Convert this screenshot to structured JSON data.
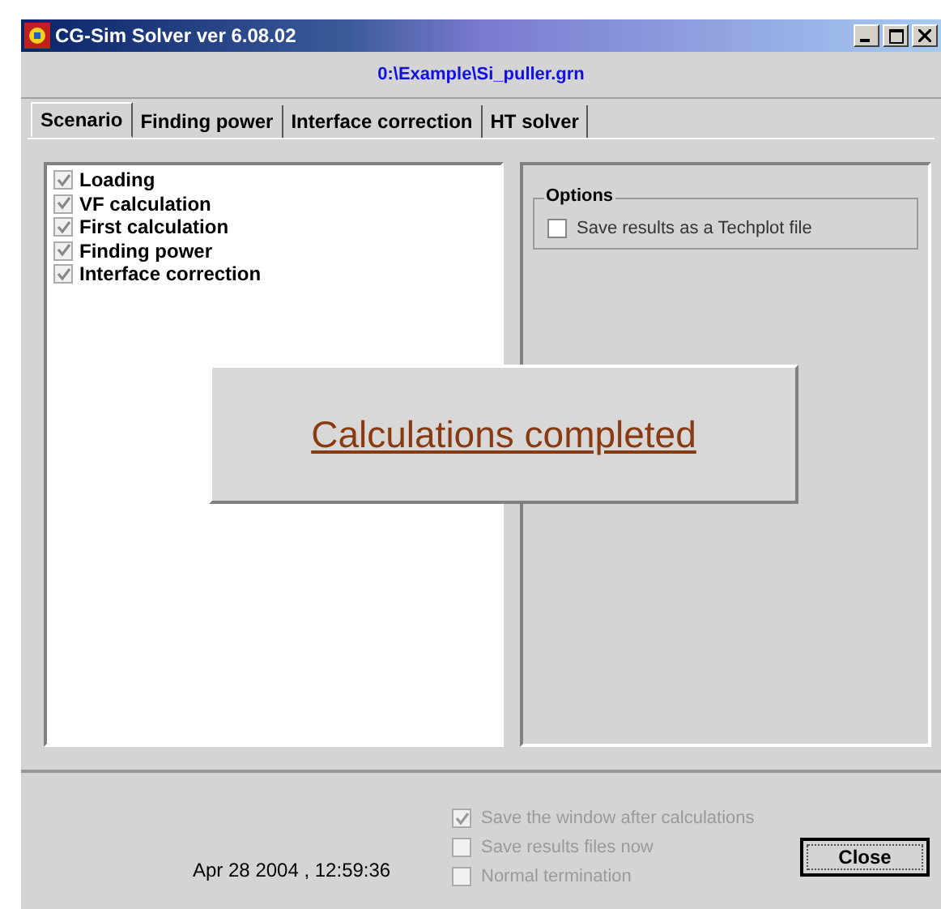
{
  "window": {
    "title": "CG-Sim Solver ver 6.08.02"
  },
  "path": "0:\\Example\\Si_puller.grn",
  "tabs": [
    {
      "label": "Scenario",
      "selected": true
    },
    {
      "label": "Finding power",
      "selected": false
    },
    {
      "label": "Interface correction",
      "selected": false
    },
    {
      "label": "HT solver",
      "selected": false
    }
  ],
  "steps": [
    {
      "label": "Loading",
      "checked": true
    },
    {
      "label": "VF calculation",
      "checked": true
    },
    {
      "label": "First calculation",
      "checked": true
    },
    {
      "label": "Finding power",
      "checked": true
    },
    {
      "label": "Interface correction",
      "checked": true
    }
  ],
  "options": {
    "title": "Options",
    "items": [
      {
        "label": "Save results as a Techplot file",
        "checked": false
      }
    ]
  },
  "message": "Calculations completed",
  "timestamp": "Apr 28 2004 , 12:59:36",
  "bottom_options": [
    {
      "label": "Save the window after calculations",
      "checked": true,
      "disabled": true
    },
    {
      "label": "Save results files now",
      "checked": false,
      "disabled": true
    },
    {
      "label": "Normal termination",
      "checked": false,
      "disabled": true
    }
  ],
  "close_button": "Close"
}
